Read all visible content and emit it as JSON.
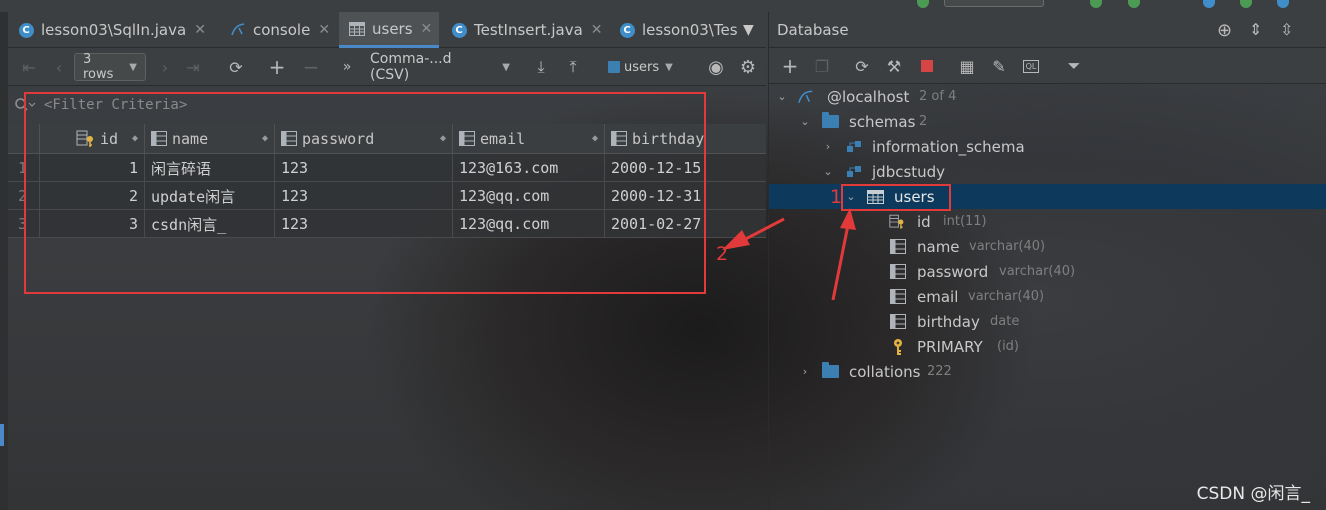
{
  "editor_tabs": [
    {
      "label": "lesson03\\SqlIn.java",
      "icon": "java-class-icon",
      "active": false
    },
    {
      "label": "console",
      "icon": "mysql-console-icon",
      "active": false
    },
    {
      "label": "users",
      "icon": "table-icon",
      "active": true
    },
    {
      "label": "TestInsert.java",
      "icon": "java-class-icon",
      "active": false
    },
    {
      "label": "lesson03\\Tes",
      "icon": "java-class-icon",
      "active": false
    }
  ],
  "toolbar": {
    "rows_combo": "3 rows",
    "export_format": "Comma-...d (CSV)",
    "table_selector": "users"
  },
  "filter": {
    "placeholder": "<Filter Criteria>"
  },
  "grid": {
    "columns": [
      "id",
      "name",
      "password",
      "email",
      "birthday"
    ],
    "rows": [
      {
        "num": "1",
        "id": "1",
        "name": "闲言碎语",
        "password": "123",
        "email": "123@163.com",
        "birthday": "2000-12-15"
      },
      {
        "num": "2",
        "id": "2",
        "name": "update闲言",
        "password": "123",
        "email": "123@qq.com",
        "birthday": "2000-12-31"
      },
      {
        "num": "3",
        "id": "3",
        "name": "csdn闲言_",
        "password": "123",
        "email": "123@qq.com",
        "birthday": "2001-02-27"
      }
    ]
  },
  "db_panel": {
    "title": "Database",
    "tree": {
      "host": {
        "label": "@localhost",
        "meta": "2 of 4"
      },
      "schemas": {
        "label": "schemas",
        "meta": "2"
      },
      "information_schema": {
        "label": "information_schema"
      },
      "jdbcstudy": {
        "label": "jdbcstudy"
      },
      "users": {
        "label": "users"
      },
      "fields": [
        {
          "name": "id",
          "type": "int(11)"
        },
        {
          "name": "name",
          "type": "varchar(40)"
        },
        {
          "name": "password",
          "type": "varchar(40)"
        },
        {
          "name": "email",
          "type": "varchar(40)"
        },
        {
          "name": "birthday",
          "type": "date"
        },
        {
          "name": "PRIMARY",
          "type": "(id)"
        }
      ],
      "collations": {
        "label": "collations",
        "meta": "222"
      }
    }
  },
  "annotations": {
    "label_1": "1",
    "label_2": "2",
    "color": "#e23a3a"
  },
  "watermark": "CSDN @闲言_",
  "colors": {
    "accent": "#4a88c7",
    "selection": "#0d3a5c",
    "panel": "#3c3f41"
  }
}
